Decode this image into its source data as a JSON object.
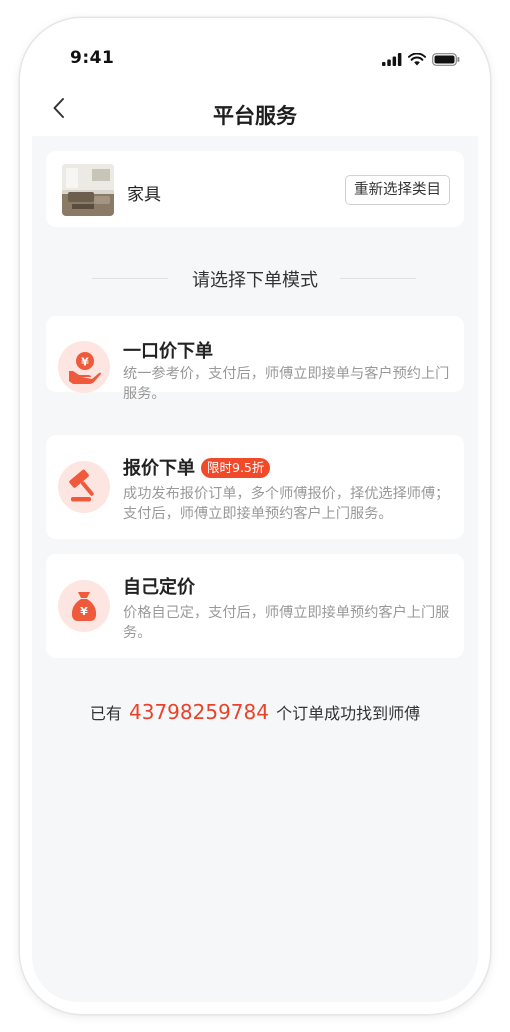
{
  "status_bar": {
    "time": "9:41"
  },
  "nav": {
    "title": "平台服务"
  },
  "category": {
    "name": "家具",
    "reselect_label": "重新选择类目"
  },
  "section": {
    "title": "请选择下单模式"
  },
  "options": [
    {
      "title": "一口价下单",
      "badge": "",
      "desc": "统一参考价，支付后，师傅立即接单与客户预约上门服务。",
      "icon": "hand-yuan-icon"
    },
    {
      "title": "报价下单",
      "badge": "限时9.5折",
      "desc": "成功发布报价订单，多个师傅报价，择优选择师傅；支付后，师傅立即接单预约客户上门服务。",
      "icon": "gavel-icon"
    },
    {
      "title": "自己定价",
      "badge": "",
      "desc": "价格自己定，支付后，师傅立即接单预约客户上门服务。",
      "icon": "money-bag-icon"
    }
  ],
  "footer": {
    "prefix": "已有",
    "count": "43798259784",
    "suffix": "个订单成功找到师傅"
  },
  "colors": {
    "accent": "#e8432a",
    "icon_bg": "#fde6e1",
    "page_bg": "#f6f7f9"
  }
}
